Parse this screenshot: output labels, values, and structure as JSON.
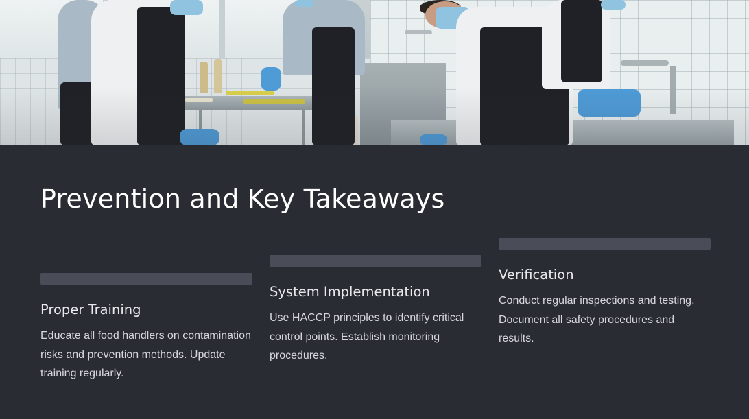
{
  "hero": {
    "image_description_icon": "kitchen-photo"
  },
  "title": "Prevention and Key Takeaways",
  "cards": [
    {
      "heading": "Proper Training",
      "body": "Educate all food handlers on contamination risks and prevention methods. Update training regularly."
    },
    {
      "heading": "System Implementation",
      "body": "Use HACCP principles to identify critical control points. Establish monitoring procedures."
    },
    {
      "heading": "Verification",
      "body": "Conduct regular inspections and testing. Document all safety procedures and results."
    }
  ],
  "colors": {
    "background": "#2a2c33",
    "bar": "#4a4d57",
    "title": "#ffffff",
    "body_text": "#d6d8dd"
  }
}
